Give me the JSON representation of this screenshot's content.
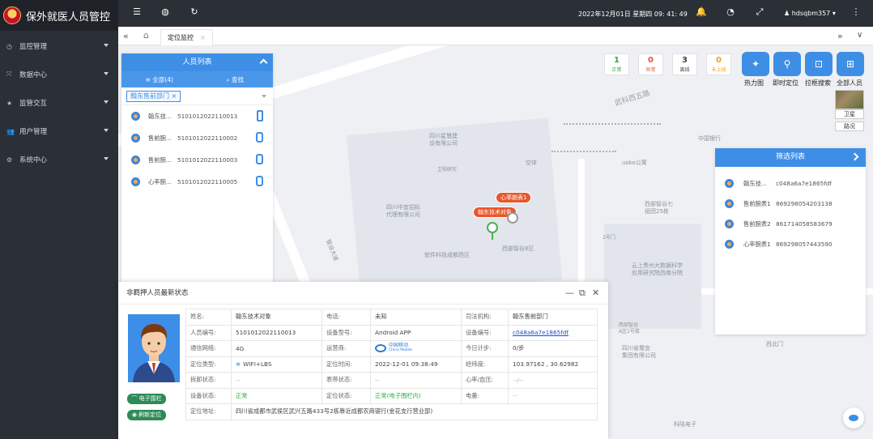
{
  "app": {
    "title": "保外就医人员管控"
  },
  "sidebar": {
    "items": [
      {
        "label": "监控管理",
        "icon": "monitor-icon",
        "glyph": "◷"
      },
      {
        "label": "数据中心",
        "icon": "data-icon",
        "glyph": "⤧"
      },
      {
        "label": "监管交互",
        "icon": "star-icon",
        "glyph": "★"
      },
      {
        "label": "用户管理",
        "icon": "users-icon",
        "glyph": "👥"
      },
      {
        "label": "系统中心",
        "icon": "gear-icon",
        "glyph": "⚙"
      }
    ]
  },
  "topbar": {
    "datetime": "2022年12月01日 星期四 09: 41: 49",
    "username": "hdsqbm357"
  },
  "tabs": {
    "active_label": "定位监控"
  },
  "person_panel": {
    "title": "人员列表",
    "tab_all": "全部(4)",
    "tab_search": "查找",
    "dept_chip": "翰东售前部门",
    "people": [
      {
        "name": "翰东技...",
        "id": "5101012022110013"
      },
      {
        "name": "售前腕...",
        "id": "5101012022110002"
      },
      {
        "name": "售前腕...",
        "id": "5101012022110003"
      },
      {
        "name": "心率腕...",
        "id": "5101012022110005"
      }
    ]
  },
  "counters": [
    {
      "num": "1",
      "label": "正常",
      "color": "#2eaa4a"
    },
    {
      "num": "0",
      "label": "异常",
      "color": "#e8562a"
    },
    {
      "num": "3",
      "label": "离线",
      "color": "#444444"
    },
    {
      "num": "0",
      "label": "未上线",
      "color": "#f0a020"
    }
  ],
  "actions": [
    {
      "label": "热力图",
      "icon": "heatmap-icon"
    },
    {
      "label": "即时定位",
      "icon": "locate-icon"
    },
    {
      "label": "拉框搜索",
      "icon": "box-search-icon"
    },
    {
      "label": "全部人员",
      "icon": "grid-icon"
    }
  ],
  "map_types": {
    "satellite": "卫星",
    "traffic": "路况"
  },
  "filter_panel": {
    "title": "筛选列表",
    "rows": [
      {
        "name": "翰东技...",
        "code": "c048a6a7e1865fdf"
      },
      {
        "name": "售前腕表1",
        "code": "869298054203138"
      },
      {
        "name": "售前腕表2",
        "code": "861714058583679"
      },
      {
        "name": "心率腕表1",
        "code": "869298057443590"
      }
    ]
  },
  "map": {
    "markers": {
      "tag1": "心率腕表1",
      "tag2": "翰东技术对象"
    },
    "labels": {
      "road1": "武科西五路",
      "l2": "四川星慧建\n设有限公司",
      "l3": "卫视研究",
      "l4": "空体",
      "l5": "uoko公寓",
      "l6": "中国银行",
      "l7": "西部智谷七\n组团25栋",
      "l8": "四川中宜招标\n代理有限公司",
      "l9": "西部智谷8区",
      "l10": "软件科技成都西区",
      "l11": "2号门",
      "l12": "云上贵州大数据科学\n应用研究院西南分院",
      "l13": "智谷大道",
      "l14": "四川省蜀宣\n集团有限公司",
      "l15": "西北门",
      "l16": "科陆电子",
      "l17": "西部智谷\nA区1号楼"
    }
  },
  "status_popup": {
    "title": "非羁押人员最新状态",
    "btn_fence": "电子围栏",
    "btn_refresh": "刷新定位",
    "rows": [
      [
        "姓名:",
        "翰东技术对象",
        "电话:",
        "未知",
        "司法机构:",
        "翰东售前部门"
      ],
      [
        "人员编号:",
        "5101012022110013",
        "设备型号:",
        "Android APP",
        "设备编号:",
        "c048a6a7e1865fdf"
      ],
      [
        "通信网络:",
        "4G",
        "运营商:",
        "中国移动",
        "今日计步:",
        "0/步"
      ],
      [
        "定位类型:",
        "WIFI+LBS",
        "定位时间:",
        "2022-12-01 09:38:49",
        "经纬度:",
        "103.97162 , 30.62982"
      ],
      [
        "拆卸状态:",
        "--",
        "表带状态:",
        "--",
        "心率/血压:",
        "--/--"
      ],
      [
        "设备状态:",
        "正常",
        "定位状态:",
        "正常(电子围栏内)",
        "电量:",
        "--"
      ],
      [
        "定位地址:",
        "四川省成都市武侯区武兴五路433号2栋靠近成都农商银行(金花支行营业部)"
      ]
    ],
    "operator_sub": "China Mobile"
  }
}
